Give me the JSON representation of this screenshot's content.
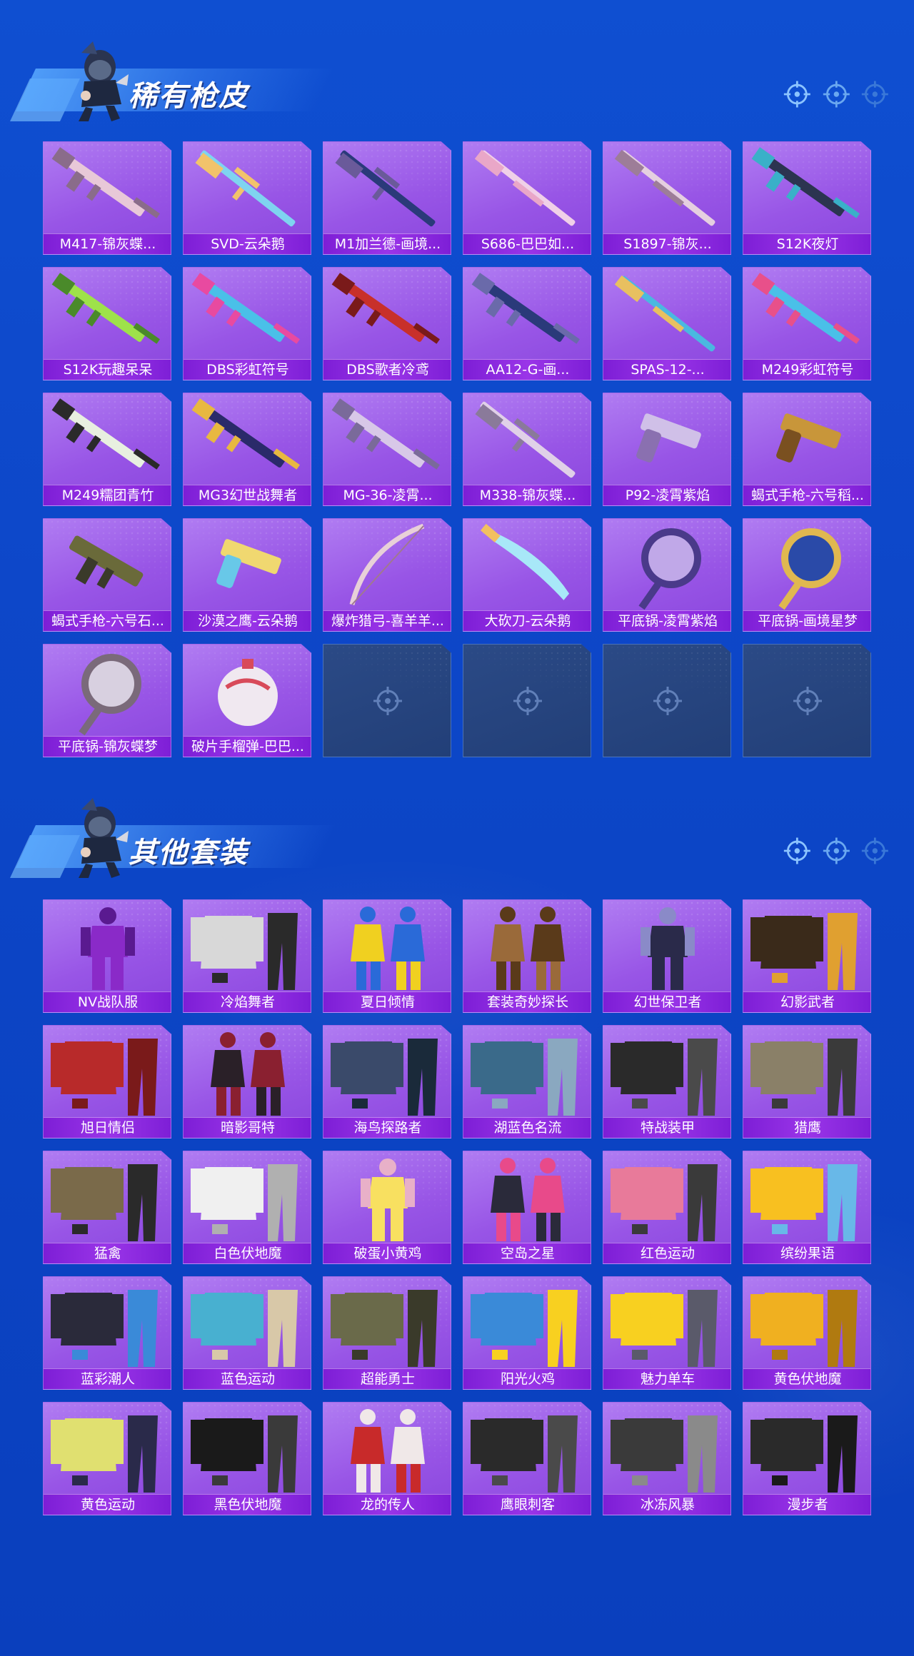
{
  "sections": [
    {
      "title": "稀有枪皮",
      "items": [
        {
          "label": "M417-锦灰蝶...",
          "kind": "rifle",
          "c1": "#e8c8d8",
          "c2": "#8a6c8a"
        },
        {
          "label": "SVD-云朵鹅",
          "kind": "sniper",
          "c1": "#7fd4f0",
          "c2": "#f2c36b"
        },
        {
          "label": "M1加兰德-画境...",
          "kind": "sniper",
          "c1": "#2a3a7a",
          "c2": "#6a5a9a"
        },
        {
          "label": "S686-巴巴如...",
          "kind": "shotgun",
          "c1": "#f0d0e8",
          "c2": "#e9a7c8"
        },
        {
          "label": "S1897-锦灰...",
          "kind": "shotgun",
          "c1": "#e5cfe0",
          "c2": "#9d7d98"
        },
        {
          "label": "S12K夜灯",
          "kind": "rifle",
          "c1": "#2c3450",
          "c2": "#3ab0c8"
        },
        {
          "label": "S12K玩趣呆呆",
          "kind": "rifle",
          "c1": "#9ee24a",
          "c2": "#4a8a2a"
        },
        {
          "label": "DBS彩虹符号",
          "kind": "rifle",
          "c1": "#4ac0e8",
          "c2": "#e84aa0"
        },
        {
          "label": "DBS歌者冷鸢",
          "kind": "rifle",
          "c1": "#c8302a",
          "c2": "#7a1a1a"
        },
        {
          "label": "AA12-G-画...",
          "kind": "rifle",
          "c1": "#2a3a7a",
          "c2": "#6a6aaa"
        },
        {
          "label": "SPAS-12-...",
          "kind": "shotgun",
          "c1": "#4ab8e0",
          "c2": "#e8c060"
        },
        {
          "label": "M249彩虹符号",
          "kind": "rifle",
          "c1": "#4ac0e8",
          "c2": "#e8508a"
        },
        {
          "label": "M249糯团青竹",
          "kind": "rifle",
          "c1": "#e8f0e0",
          "c2": "#2a2a2a"
        },
        {
          "label": "MG3幻世战舞者",
          "kind": "rifle",
          "c1": "#2a2a6a",
          "c2": "#e8b840"
        },
        {
          "label": "MG-36-凌霄...",
          "kind": "rifle",
          "c1": "#d8c8e8",
          "c2": "#7a6a9a"
        },
        {
          "label": "M338-锦灰蝶...",
          "kind": "sniper",
          "c1": "#e0d0e8",
          "c2": "#8a7a9a"
        },
        {
          "label": "P92-凌霄紫焰",
          "kind": "pistol",
          "c1": "#d0c0e8",
          "c2": "#8a70b0"
        },
        {
          "label": "蝎式手枪-六号稻...",
          "kind": "pistol",
          "c1": "#c8963a",
          "c2": "#7a5020"
        },
        {
          "label": "蝎式手枪-六号石...",
          "kind": "smg",
          "c1": "#6a6a3a",
          "c2": "#3a3a2a"
        },
        {
          "label": "沙漠之鹰-云朵鹅",
          "kind": "pistol",
          "c1": "#f0d870",
          "c2": "#68c8e8"
        },
        {
          "label": "爆炸猎弓-喜羊羊...",
          "kind": "bow",
          "c1": "#e8d0d8",
          "c2": "#a07890"
        },
        {
          "label": "大砍刀-云朵鹅",
          "kind": "blade",
          "c1": "#a8e8f8",
          "c2": "#f2c060"
        },
        {
          "label": "平底锅-凌霄紫焰",
          "kind": "pan",
          "c1": "#c0a8e8",
          "c2": "#4a3a8a"
        },
        {
          "label": "平底锅-画境星梦",
          "kind": "pan",
          "c1": "#2a4aa8",
          "c2": "#e0b850"
        },
        {
          "label": "平底锅-锦灰蝶梦",
          "kind": "pan",
          "c1": "#d8d0e0",
          "c2": "#7a6a7a"
        },
        {
          "label": "破片手榴弹-巴巴...",
          "kind": "grenade",
          "c1": "#f0e8f0",
          "c2": "#d84a5a"
        }
      ],
      "empty_slots": 4
    },
    {
      "title": "其他套装",
      "items": [
        {
          "label": "NV战队服",
          "kind": "suit",
          "c1": "#8a2ac8",
          "c2": "#5a1a90"
        },
        {
          "label": "冷焰舞者",
          "kind": "outfit",
          "c1": "#d8d8d8",
          "c2": "#2a2a2a"
        },
        {
          "label": "夏日倾情",
          "kind": "pair",
          "c1": "#f0d020",
          "c2": "#2a6ad8"
        },
        {
          "label": "套装奇妙探长",
          "kind": "pair",
          "c1": "#9a6a3a",
          "c2": "#5a3a1a"
        },
        {
          "label": "幻世保卫者",
          "kind": "suit",
          "c1": "#2a2a4a",
          "c2": "#8a8ac8"
        },
        {
          "label": "幻影武者",
          "kind": "outfit",
          "c1": "#3a2a1a",
          "c2": "#e0a030"
        },
        {
          "label": "旭日情侣",
          "kind": "outfit",
          "c1": "#b82a2a",
          "c2": "#7a1a1a"
        },
        {
          "label": "暗影哥特",
          "kind": "pair",
          "c1": "#2a2028",
          "c2": "#8a2030"
        },
        {
          "label": "海鸟探路者",
          "kind": "outfit",
          "c1": "#3a4a6a",
          "c2": "#1a2a3a"
        },
        {
          "label": "湖蓝色名流",
          "kind": "outfit",
          "c1": "#3a6a8a",
          "c2": "#8aa8c0"
        },
        {
          "label": "特战装甲",
          "kind": "outfit",
          "c1": "#2a2a2a",
          "c2": "#4a4a4a"
        },
        {
          "label": "猎鹰",
          "kind": "outfit",
          "c1": "#8a8068",
          "c2": "#3a3a3a"
        },
        {
          "label": "猛禽",
          "kind": "outfit",
          "c1": "#7a6a4a",
          "c2": "#2a2a2a"
        },
        {
          "label": "白色伏地魔",
          "kind": "outfit",
          "c1": "#f0f0f0",
          "c2": "#b0b0b0"
        },
        {
          "label": "破蛋小黄鸡",
          "kind": "suit",
          "c1": "#f8e060",
          "c2": "#e8b0c8"
        },
        {
          "label": "空岛之星",
          "kind": "pair",
          "c1": "#2a2a3a",
          "c2": "#e84a8a"
        },
        {
          "label": "红色运动",
          "kind": "outfit",
          "c1": "#e87a9a",
          "c2": "#3a3a3a"
        },
        {
          "label": "缤纷果语",
          "kind": "outfit",
          "c1": "#f8c020",
          "c2": "#68b8e8"
        },
        {
          "label": "蓝彩潮人",
          "kind": "outfit",
          "c1": "#2a2a3a",
          "c2": "#3a8ad8"
        },
        {
          "label": "蓝色运动",
          "kind": "outfit",
          "c1": "#48b0d0",
          "c2": "#d8c8a8"
        },
        {
          "label": "超能勇士",
          "kind": "outfit",
          "c1": "#6a6a4a",
          "c2": "#3a3a2a"
        },
        {
          "label": "阳光火鸡",
          "kind": "outfit",
          "c1": "#3a8ad8",
          "c2": "#f8d020"
        },
        {
          "label": "魅力单车",
          "kind": "outfit",
          "c1": "#f8d020",
          "c2": "#5a5a6a"
        },
        {
          "label": "黄色伏地魔",
          "kind": "outfit",
          "c1": "#f0b020",
          "c2": "#b07a10"
        },
        {
          "label": "黄色运动",
          "kind": "outfit",
          "c1": "#e0e070",
          "c2": "#2a2a4a"
        },
        {
          "label": "黑色伏地魔",
          "kind": "outfit",
          "c1": "#1a1a1a",
          "c2": "#3a3a3a"
        },
        {
          "label": "龙的传人",
          "kind": "pair",
          "c1": "#c82a2a",
          "c2": "#f0e8e8"
        },
        {
          "label": "鹰眼刺客",
          "kind": "outfit",
          "c1": "#2a2a2a",
          "c2": "#4a4a4a"
        },
        {
          "label": "冰冻风暴",
          "kind": "outfit",
          "c1": "#3a3a3a",
          "c2": "#8a8a8a"
        },
        {
          "label": "漫步者",
          "kind": "outfit",
          "c1": "#2a2a2a",
          "c2": "#1a1a1a"
        }
      ],
      "empty_slots": 0
    }
  ]
}
